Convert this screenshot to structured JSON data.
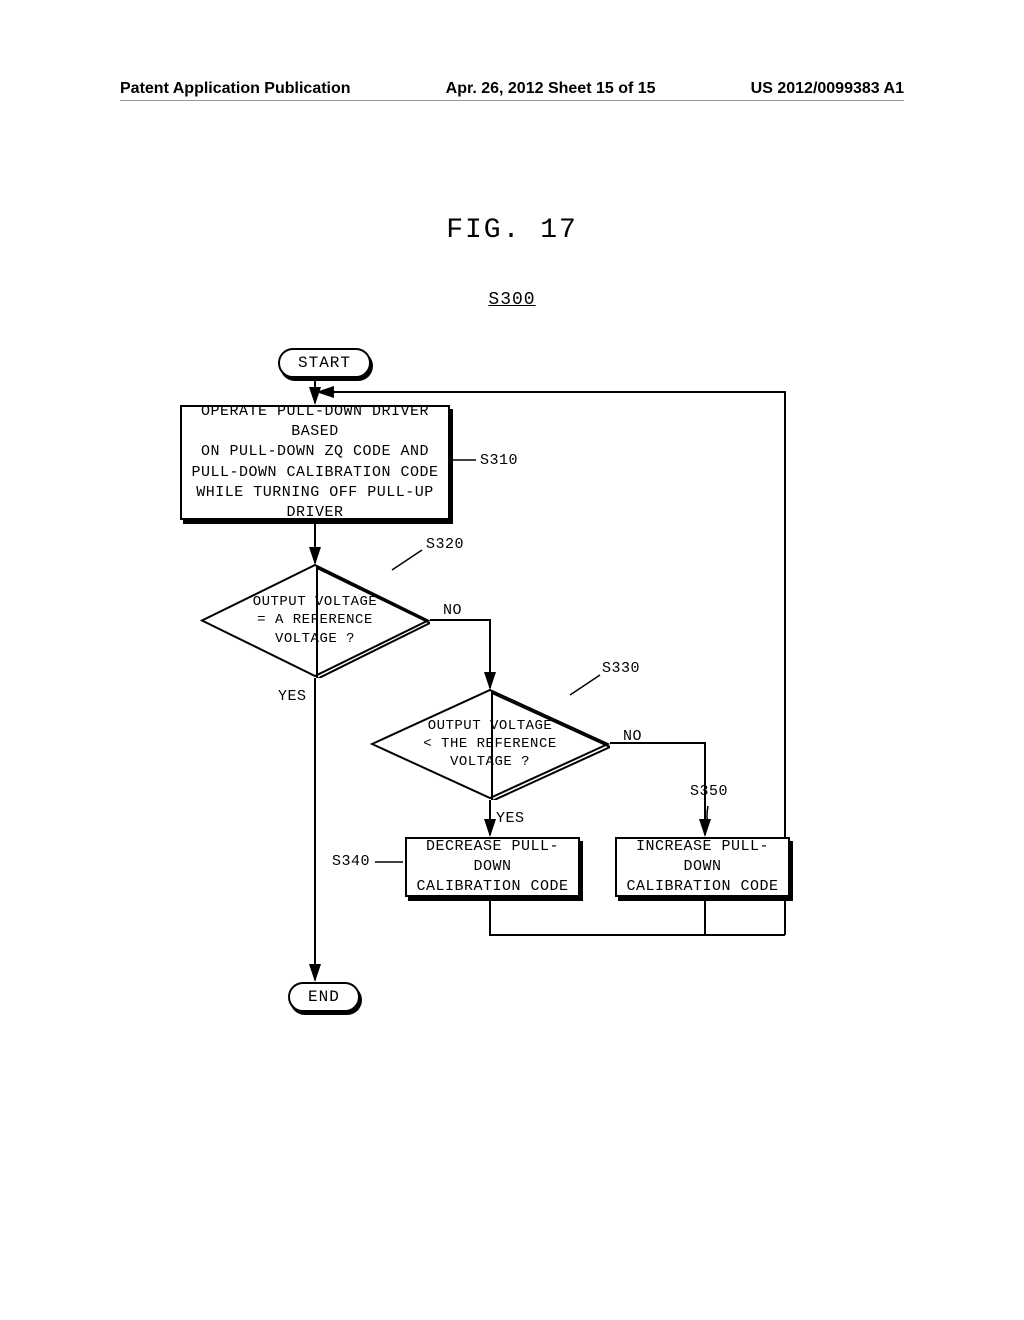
{
  "header": {
    "left": "Patent Application Publication",
    "center": "Apr. 26, 2012  Sheet 15 of 15",
    "right": "US 2012/0099383 A1"
  },
  "figure": {
    "title": "FIG. 17",
    "id": "S300"
  },
  "flow": {
    "start": "START",
    "end": "END",
    "s310": {
      "ref": "S310",
      "text1": "OPERATE PULL-DOWN DRIVER BASED",
      "text2": "ON PULL-DOWN ZQ CODE AND",
      "text3": "PULL-DOWN CALIBRATION CODE",
      "text4": "WHILE TURNING OFF PULL-UP",
      "text5": "DRIVER"
    },
    "s320": {
      "ref": "S320",
      "text1": "OUTPUT VOLTAGE",
      "text2": "= A REFERENCE",
      "text3": "VOLTAGE ?",
      "yes": "YES",
      "no": "NO"
    },
    "s330": {
      "ref": "S330",
      "text1": "OUTPUT VOLTAGE",
      "text2": "< THE REFERENCE",
      "text3": "VOLTAGE ?",
      "yes": "YES",
      "no": "NO"
    },
    "s340": {
      "ref": "S340",
      "text1": "DECREASE PULL-DOWN",
      "text2": "CALIBRATION CODE"
    },
    "s350": {
      "ref": "S350",
      "text1": "INCREASE PULL-DOWN",
      "text2": "CALIBRATION CODE"
    }
  }
}
